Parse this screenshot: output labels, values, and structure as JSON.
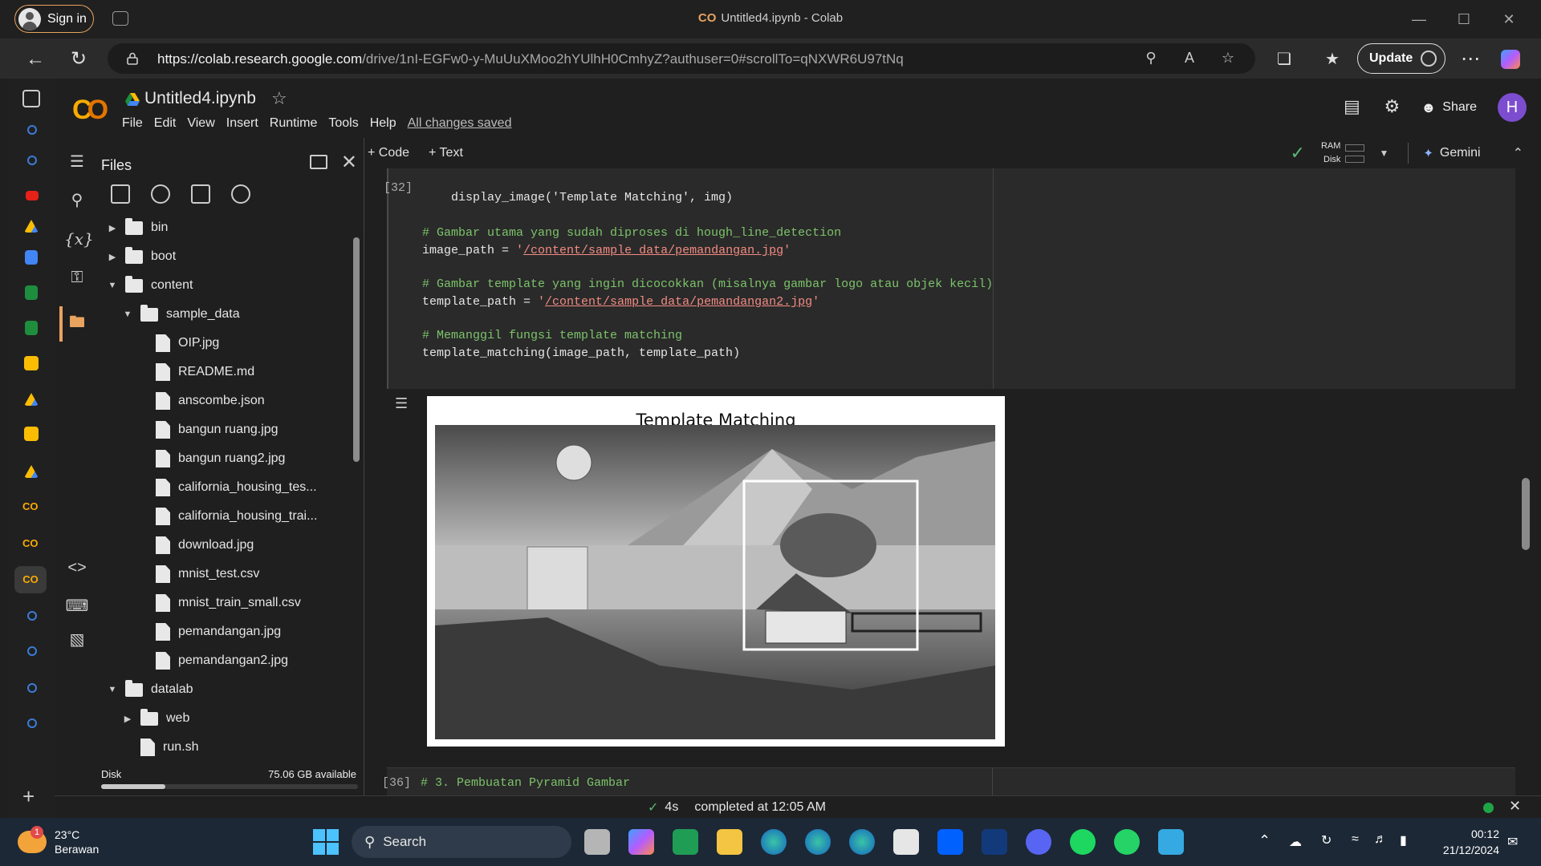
{
  "browser": {
    "signin_label": "Sign in",
    "window_title": "Untitled4.ipynb - Colab",
    "window_title_logo": "CO",
    "url_host": "https://colab.research.google.com",
    "url_path": "/drive/1nI-EGFw0-y-MuUuXMoo2hYUlhH0CmhyZ?authuser=0#scrollTo=qNXWR6U97tNq",
    "update_label": "Update"
  },
  "colab": {
    "notebook_title": "Untitled4.ipynb",
    "menu": [
      "File",
      "Edit",
      "View",
      "Insert",
      "Runtime",
      "Tools",
      "Help"
    ],
    "save_status": "All changes saved",
    "share_label": "Share",
    "avatar_letter": "H",
    "toolbar": {
      "add_code": "+ Code",
      "add_text": "+ Text",
      "ram_label": "RAM",
      "disk_label": "Disk",
      "gemini_label": "Gemini"
    }
  },
  "files_panel": {
    "title": "Files",
    "tree": [
      {
        "name": "bin",
        "type": "folder",
        "level": 0,
        "expanded": false
      },
      {
        "name": "boot",
        "type": "folder",
        "level": 0,
        "expanded": false
      },
      {
        "name": "content",
        "type": "folder",
        "level": 0,
        "expanded": true
      },
      {
        "name": "sample_data",
        "type": "folder",
        "level": 1,
        "expanded": true
      },
      {
        "name": "OIP.jpg",
        "type": "file",
        "level": 2
      },
      {
        "name": "README.md",
        "type": "file",
        "level": 2
      },
      {
        "name": "anscombe.json",
        "type": "file",
        "level": 2
      },
      {
        "name": "bangun ruang.jpg",
        "type": "file",
        "level": 2
      },
      {
        "name": "bangun ruang2.jpg",
        "type": "file",
        "level": 2
      },
      {
        "name": "california_housing_tes...",
        "type": "file",
        "level": 2
      },
      {
        "name": "california_housing_trai...",
        "type": "file",
        "level": 2
      },
      {
        "name": "download.jpg",
        "type": "file",
        "level": 2
      },
      {
        "name": "mnist_test.csv",
        "type": "file",
        "level": 2
      },
      {
        "name": "mnist_train_small.csv",
        "type": "file",
        "level": 2
      },
      {
        "name": "pemandangan.jpg",
        "type": "file",
        "level": 2
      },
      {
        "name": "pemandangan2.jpg",
        "type": "file",
        "level": 2
      },
      {
        "name": "datalab",
        "type": "folder",
        "level": 0,
        "expanded": true
      },
      {
        "name": "web",
        "type": "folder",
        "level": 1,
        "expanded": false
      },
      {
        "name": "run.sh",
        "type": "file",
        "level": 1
      }
    ],
    "disk_label": "Disk",
    "disk_available": "75.06 GB available",
    "disk_used_fraction": 0.25
  },
  "cell1": {
    "exec_count": "[32]",
    "lines": {
      "l1": "    display_image('Template Matching', img)",
      "c1": "# Gambar utama yang sudah diproses di hough_line_detection",
      "l2a": "image_path = ",
      "l2s": "/content/sample_data/pemandangan.jpg",
      "c2": "# Gambar template yang ingin dicocokkan (misalnya gambar logo atau objek kecil)",
      "l3a": "template_path = ",
      "l3s": "/content/sample_data/pemandangan2.jpg",
      "c3": "# Memanggil fungsi template matching",
      "l4": "template_matching(image_path, template_path)"
    },
    "output_title": "Template Matching"
  },
  "cell2": {
    "exec_count": "[36]",
    "code": "# 3. Pembuatan Pyramid Gambar"
  },
  "statusbar": {
    "duration": "4s",
    "completed": "completed at 12:05 AM"
  },
  "taskbar": {
    "temp": "23°C",
    "weather": "Berawan",
    "search_label": "Search",
    "time": "00:12",
    "date": "21/12/2024"
  }
}
